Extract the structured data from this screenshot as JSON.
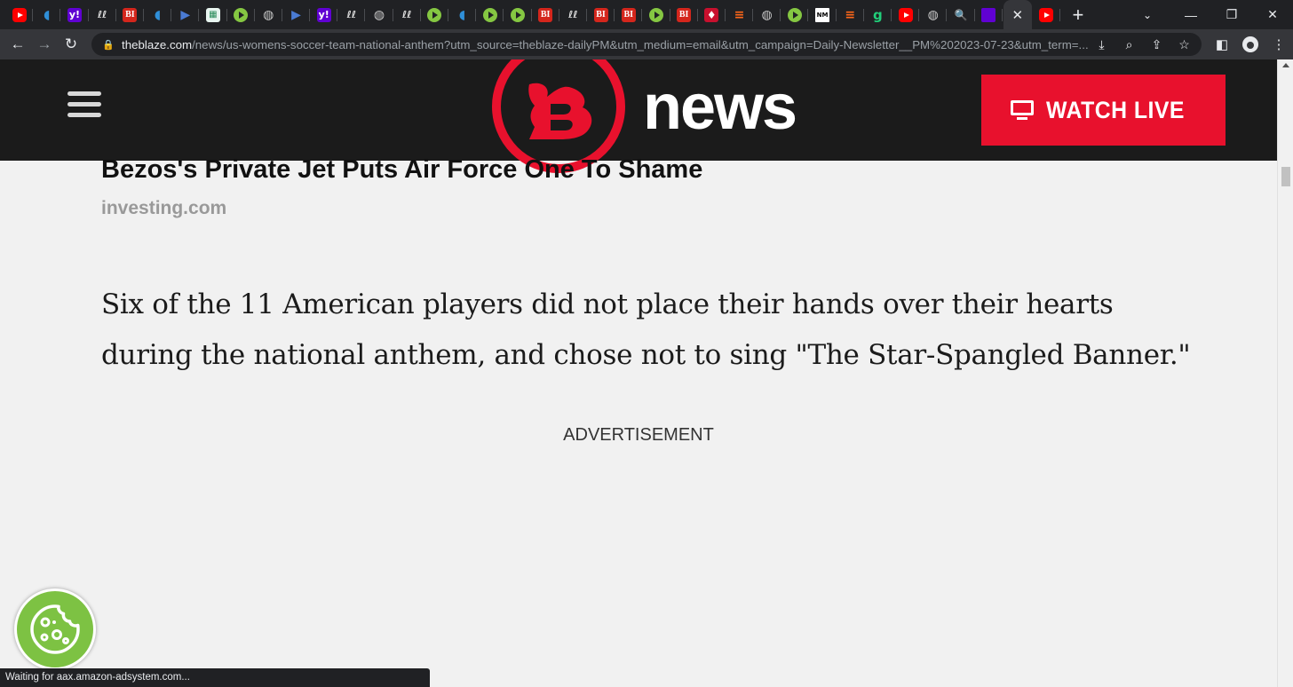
{
  "browser": {
    "tabs": [
      {
        "icon": "youtube-icon",
        "glyph": ""
      },
      {
        "icon": "shield-icon",
        "glyph": "◖"
      },
      {
        "icon": "yahoo-icon",
        "glyph": "y!"
      },
      {
        "icon": "lli-icon",
        "glyph": "ℓℓ"
      },
      {
        "icon": "business-insider-icon",
        "glyph": "BI"
      },
      {
        "icon": "shield-icon",
        "glyph": "◖"
      },
      {
        "icon": "arrow-icon",
        "glyph": "▶"
      },
      {
        "icon": "grid-icon",
        "glyph": "▦"
      },
      {
        "icon": "rumble-icon",
        "glyph": ""
      },
      {
        "icon": "globe-icon",
        "glyph": "◍"
      },
      {
        "icon": "arrow-icon",
        "glyph": "▶"
      },
      {
        "icon": "yahoo-icon",
        "glyph": "y!"
      },
      {
        "icon": "lli-icon",
        "glyph": "ℓℓ"
      },
      {
        "icon": "globe-icon",
        "glyph": "◍"
      },
      {
        "icon": "lli-icon",
        "glyph": "ℓℓ"
      },
      {
        "icon": "rumble-icon",
        "glyph": ""
      },
      {
        "icon": "shield-icon",
        "glyph": "◖"
      },
      {
        "icon": "rumble-icon",
        "glyph": ""
      },
      {
        "icon": "rumble-icon",
        "glyph": ""
      },
      {
        "icon": "business-insider-icon",
        "glyph": "BI"
      },
      {
        "icon": "lli-icon",
        "glyph": "ℓℓ"
      },
      {
        "icon": "business-insider-icon",
        "glyph": "BI"
      },
      {
        "icon": "business-insider-icon",
        "glyph": "BI"
      },
      {
        "icon": "rumble-icon",
        "glyph": ""
      },
      {
        "icon": "business-insider-icon",
        "glyph": "BI"
      },
      {
        "icon": "redbar-icon",
        "glyph": "♦"
      },
      {
        "icon": "substack-icon",
        "glyph": "≡"
      },
      {
        "icon": "globe-icon",
        "glyph": "◍"
      },
      {
        "icon": "rumble-icon",
        "glyph": ""
      },
      {
        "icon": "newsmax-icon",
        "glyph": "NM"
      },
      {
        "icon": "substack-icon",
        "glyph": "≡"
      },
      {
        "icon": "gab-icon",
        "glyph": "g"
      },
      {
        "icon": "youtube-icon",
        "glyph": ""
      },
      {
        "icon": "globe-icon",
        "glyph": "◍"
      },
      {
        "icon": "search-icon",
        "glyph": "🔍"
      },
      {
        "icon": "mail-icon",
        "glyph": ""
      },
      {
        "icon": "close-icon",
        "glyph": "✕",
        "active": true
      },
      {
        "icon": "youtube-icon",
        "glyph": ""
      }
    ],
    "new_tab_glyph": "+",
    "address_host": "theblaze.com",
    "address_path": "/news/us-womens-soccer-team-national-anthem?utm_source=theblaze-dailyPM&utm_medium=email&utm_campaign=Daily-Newsletter__PM%202023-07-23&utm_term=...",
    "status_text": "Waiting for aax.amazon-adsystem.com..."
  },
  "site": {
    "logo_text": "news",
    "watch_live_label": "WATCH LIVE",
    "brand_red": "#e8112d",
    "header_bg": "#1b1b1b"
  },
  "article": {
    "promo_title": "Bezos's Private Jet Puts Air Force One To Shame",
    "promo_source": "investing.com",
    "paragraph": "Six of the 11 American players did not place their hands over their hearts during the national anthem, and chose not to sing \"The Star-Spangled Banner.\"",
    "ad_label": "ADVERTISEMENT"
  },
  "cookie": {
    "icon": "cookie-icon",
    "color": "#7dc243"
  }
}
